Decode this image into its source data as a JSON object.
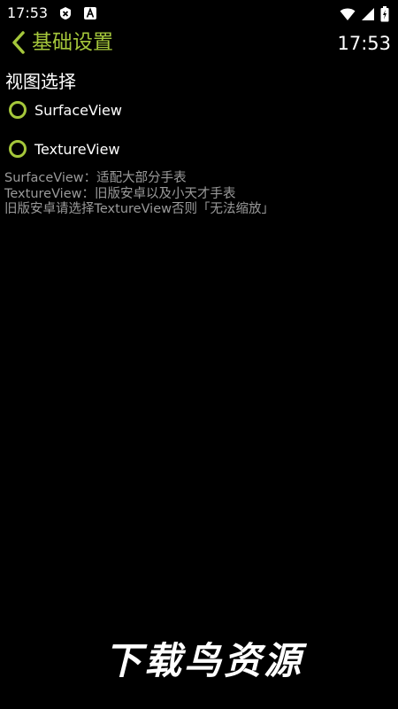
{
  "status_bar": {
    "time": "17:53",
    "icons": [
      "x-notification-icon",
      "a-notification-icon",
      "wifi-icon",
      "signal-icon",
      "battery-icon"
    ]
  },
  "header": {
    "title": "基础设置",
    "clock": "17:53",
    "accent_color": "#a5c73b"
  },
  "section": {
    "title": "视图选择"
  },
  "options": [
    {
      "label": "SurfaceView",
      "selected": false
    },
    {
      "label": "TextureView",
      "selected": false
    }
  ],
  "description": {
    "lines": [
      "SurfaceView：适配大部分手表",
      "TextureView：旧版安卓以及小天才手表",
      "旧版安卓请选择TextureView否则「无法缩放」"
    ]
  },
  "watermark": "下载鸟资源"
}
